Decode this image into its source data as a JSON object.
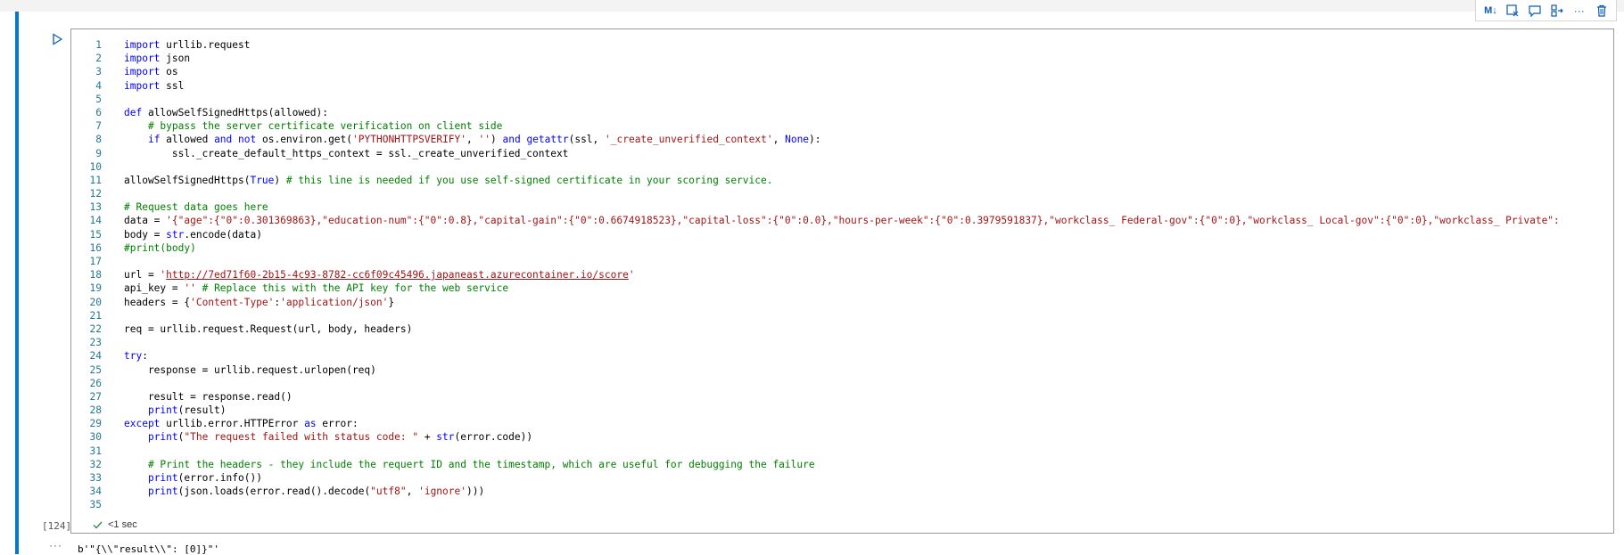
{
  "toolbar": {
    "buttons": [
      {
        "name": "markdown-toggle",
        "label": "M↓"
      },
      {
        "name": "clear-output",
        "icon": "clear-output-icon"
      },
      {
        "name": "add-comment",
        "icon": "comment-icon"
      },
      {
        "name": "split-cell",
        "icon": "split-cell-icon"
      },
      {
        "name": "more-actions",
        "label": "···"
      },
      {
        "name": "delete-cell",
        "icon": "trash-icon"
      }
    ]
  },
  "cell": {
    "execution_count": "[124]",
    "status_time": "<1 sec",
    "output_more": "···",
    "output_text": "b'\"{\\\\\"result\\\\\": [0]}\"'",
    "lines": [
      "import urllib.request",
      "import json",
      "import os",
      "import ssl",
      "",
      "def allowSelfSignedHttps(allowed):",
      "    # bypass the server certificate verification on client side",
      "    if allowed and not os.environ.get('PYTHONHTTPSVERIFY', '') and getattr(ssl, '_create_unverified_context', None):",
      "        ssl._create_default_https_context = ssl._create_unverified_context",
      "",
      "allowSelfSignedHttps(True) # this line is needed if you use self-signed certificate in your scoring service.",
      "",
      "# Request data goes here",
      "data = '{\"age\":{\"0\":0.301369863},\"education-num\":{\"0\":0.8},\"capital-gain\":{\"0\":0.6674918523},\"capital-loss\":{\"0\":0.0},\"hours-per-week\":{\"0\":0.3979591837},\"workclass_ Federal-gov\":{\"0\":0},\"workclass_ Local-gov\":{\"0\":0},\"workclass_ Private\":",
      "body = str.encode(data)",
      "#print(body)",
      "",
      "url = 'http://7ed71f60-2b15-4c93-8782-cc6f09c45496.japaneast.azurecontainer.io/score'",
      "api_key = '' # Replace this with the API key for the web service",
      "headers = {'Content-Type':'application/json'}",
      "",
      "req = urllib.request.Request(url, body, headers)",
      "",
      "try:",
      "    response = urllib.request.urlopen(req)",
      "",
      "    result = response.read()",
      "    print(result)",
      "except urllib.error.HTTPError as error:",
      "    print(\"The request failed with status code: \" + str(error.code))",
      "",
      "    # Print the headers - they include the requert ID and the timestamp, which are useful for debugging the failure",
      "    print(error.info())",
      "    print(json.loads(error.read().decode(\"utf8\", 'ignore')))",
      ""
    ]
  },
  "colors": {
    "keyword": "#0000ff",
    "string": "#a31515",
    "comment": "#008000",
    "line_number": "#237893",
    "accent": "#0078d4"
  }
}
